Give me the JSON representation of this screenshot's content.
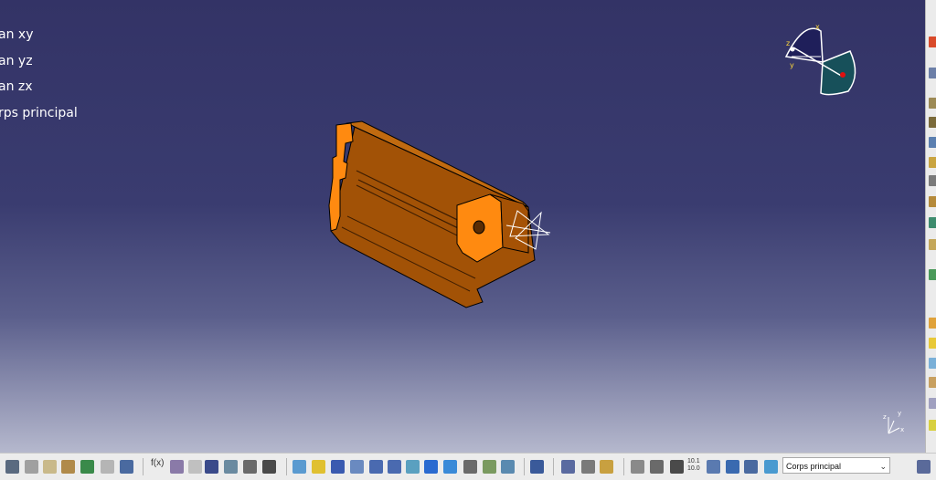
{
  "tree": {
    "items": [
      {
        "label": "an xy"
      },
      {
        "label": "an yz"
      },
      {
        "label": "an zx"
      },
      {
        "label": "rps principal"
      }
    ]
  },
  "compass": {
    "x_label": "x",
    "y_label": "y",
    "z_label": "z"
  },
  "mini_axis": {
    "x_label": "x",
    "y_label": "y",
    "z_label": "z"
  },
  "toolbar": {
    "body_selector": {
      "value": "Corps principal"
    },
    "formula_label": "f(x)",
    "grid_label_top": "10.1",
    "grid_label_bottom": "10.0"
  },
  "colors": {
    "background_top": "#333366",
    "background_bottom": "#b5b8cd",
    "part_face": "#ff8a10",
    "part_side": "#a55205",
    "part_top": "#c46a0d",
    "compass_fill": "#1f1f5a",
    "compass_teal": "#17505a"
  }
}
